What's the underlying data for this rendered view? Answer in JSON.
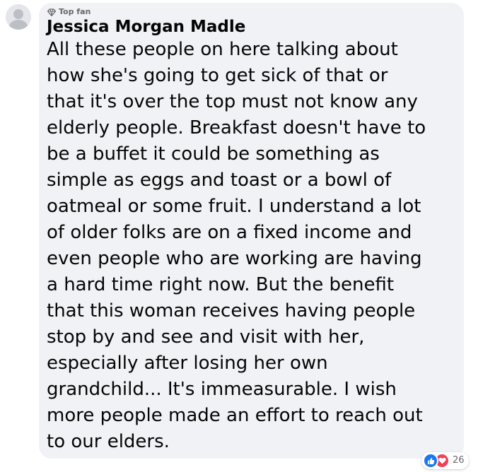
{
  "comment": {
    "badge_label": "Top fan",
    "badge_icon": "diamond-icon",
    "author": "Jessica Morgan Madle",
    "text": "All these people on here talking about\nhow she's going to get sick of that or\nthat it's over the top must not know any\nelderly people. Breakfast doesn't have to\nbe a buffet it could be something as\nsimple as eggs and toast or a bowl of\noatmeal or some fruit. I understand a lot\nof older folks are on a fixed income and\neven people who are working are having\na hard time right now. But the benefit\nthat this woman receives having people\nstop by and see and visit with her,\nespecially after losing her own\ngrandchild... It's immeasurable. I wish\nmore people made an effort to reach out\nto our elders.",
    "reactions": {
      "icons": [
        "like-icon",
        "love-icon"
      ],
      "count": "26"
    }
  },
  "colors": {
    "bubble_bg": "#f0f2f5",
    "text": "#050505",
    "secondary_text": "#65676b",
    "like_blue": "#1877f2",
    "love_red": "#f33e58",
    "avatar_bg": "#e4e6eb"
  }
}
